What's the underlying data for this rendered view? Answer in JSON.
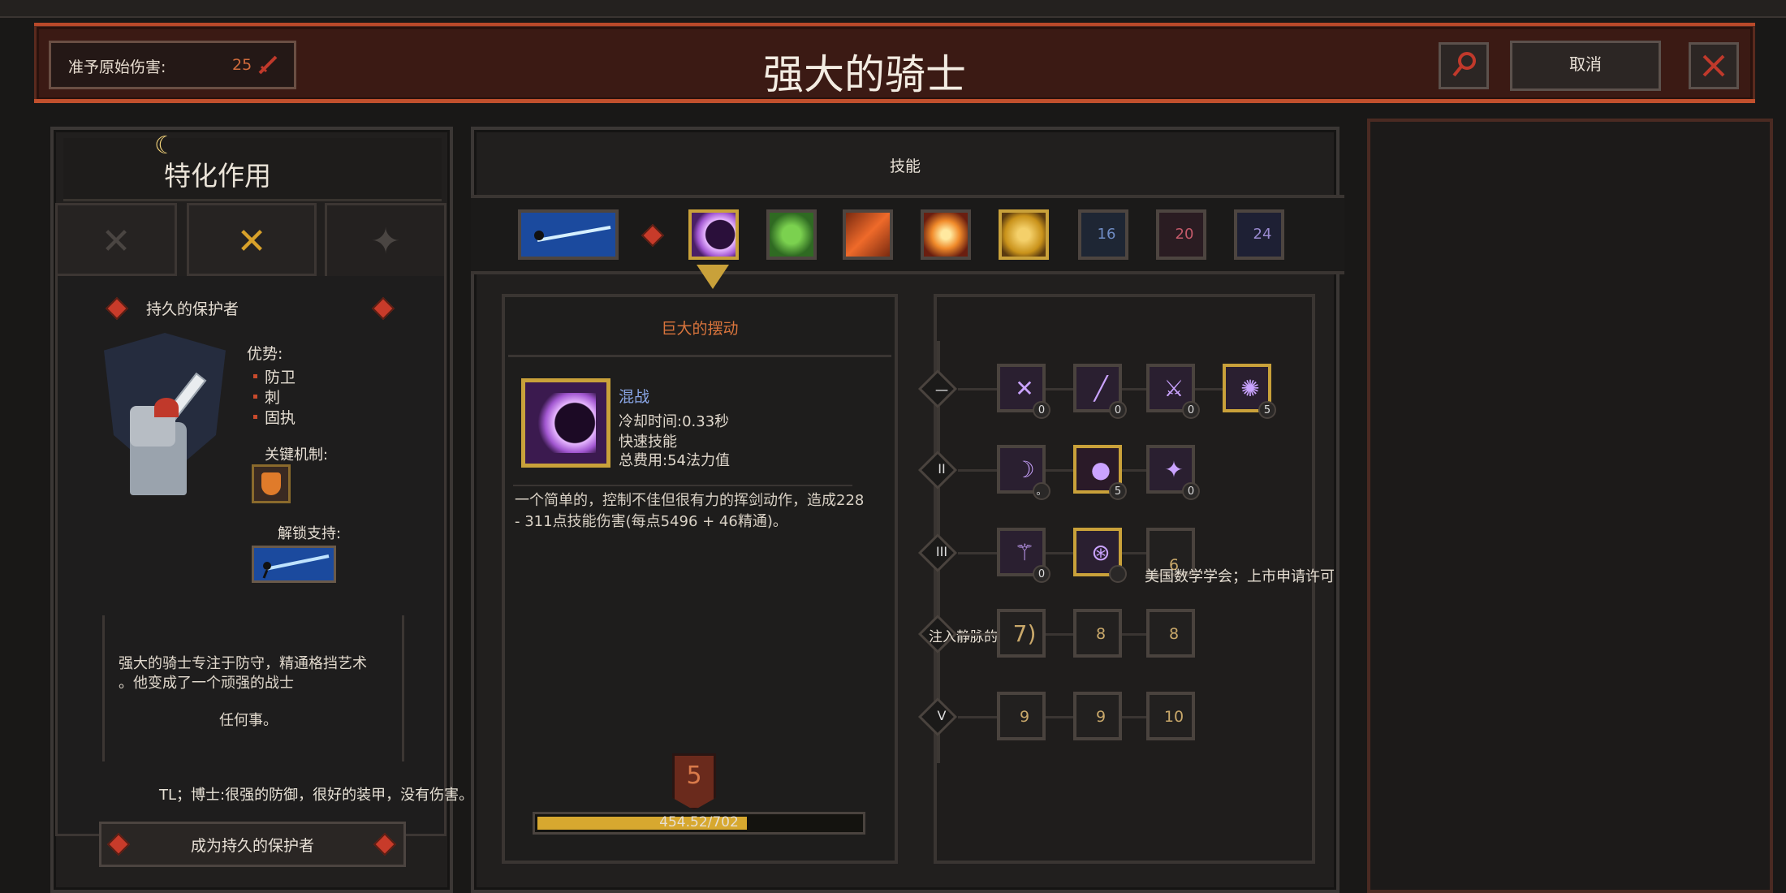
{
  "header": {
    "stat_label": "准予原始伤害:",
    "stat_value": "25",
    "title": "强大的骑士",
    "cancel_label": "取消"
  },
  "spec": {
    "title": "特化作用",
    "name": "持久的保护者",
    "advantages_label": "优势:",
    "advantages": [
      "防卫",
      "刺",
      "固执"
    ],
    "key_mechanic_label": "关键机制:",
    "unlock_label": "解锁支持:",
    "description_lines": [
      "强大的骑士专注于防守，精通格挡艺术",
      "。他变成了一个顽强的战士"
    ],
    "description_tail": "任何事。",
    "tl_note": "TL；博士:很强的防御，很好的装甲，没有伤害。",
    "become_button": "成为持久的保护者"
  },
  "skills": {
    "heading": "技能",
    "slots": [
      {
        "name": "lance-skill",
        "color": "#2a6fd6"
      },
      {
        "name": "crescent-skill",
        "color": "#b86bff",
        "gold": true
      },
      {
        "name": "green-skill",
        "color": "#5aa33a"
      },
      {
        "name": "fire-slash-skill",
        "color": "#e0622a"
      },
      {
        "name": "burst-skill",
        "color": "#f08a2a"
      },
      {
        "name": "dash-skill",
        "color": "#d8a12a",
        "gold": true
      },
      {
        "name": "locked-16",
        "label": "16"
      },
      {
        "name": "locked-20",
        "label": "20"
      },
      {
        "name": "locked-24",
        "label": "24"
      }
    ]
  },
  "detail": {
    "title": "巨大的摆动",
    "type": "混战",
    "cooldown": "冷却时间:0.33秒",
    "speed": "快速技能",
    "cost": "总费用:54法力值",
    "description": "一个简单的，控制不佳但很有力的挥剑动作，造成228 - 311点技能伤害(每点5496 + 46精通)。",
    "level": "5",
    "xp_text": "454.52/702",
    "xp_fraction": 0.647
  },
  "tree": {
    "tiers": [
      {
        "label": "一",
        "nodes": [
          {
            "name": "node-1-1",
            "count": "0"
          },
          {
            "name": "node-1-2",
            "count": "0"
          },
          {
            "name": "node-1-3",
            "count": "0"
          },
          {
            "name": "node-1-4",
            "count": "5",
            "gold": true
          }
        ]
      },
      {
        "label": "II",
        "nodes": [
          {
            "name": "node-2-1",
            "count": "。"
          },
          {
            "name": "node-2-2",
            "count": "5",
            "gold": true
          },
          {
            "name": "node-2-3",
            "count": "0"
          }
        ]
      },
      {
        "label": "III",
        "nodes": [
          {
            "name": "node-3-1",
            "count": "0"
          },
          {
            "name": "node-3-2",
            "count": "",
            "gold": true
          },
          {
            "name": "node-3-3",
            "req": "6"
          }
        ]
      },
      {
        "label": "注入静脉的",
        "nodes": [
          {
            "name": "node-4-1",
            "req": "7)"
          },
          {
            "name": "node-4-2",
            "req": "8"
          },
          {
            "name": "node-4-3",
            "req": "8"
          }
        ]
      },
      {
        "label": "V",
        "nodes": [
          {
            "name": "node-5-1",
            "req": "9"
          },
          {
            "name": "node-5-2",
            "req": "9"
          },
          {
            "name": "node-5-3",
            "req": "10"
          }
        ]
      }
    ],
    "tooltip": "美国数学学会；上市申请许可"
  }
}
